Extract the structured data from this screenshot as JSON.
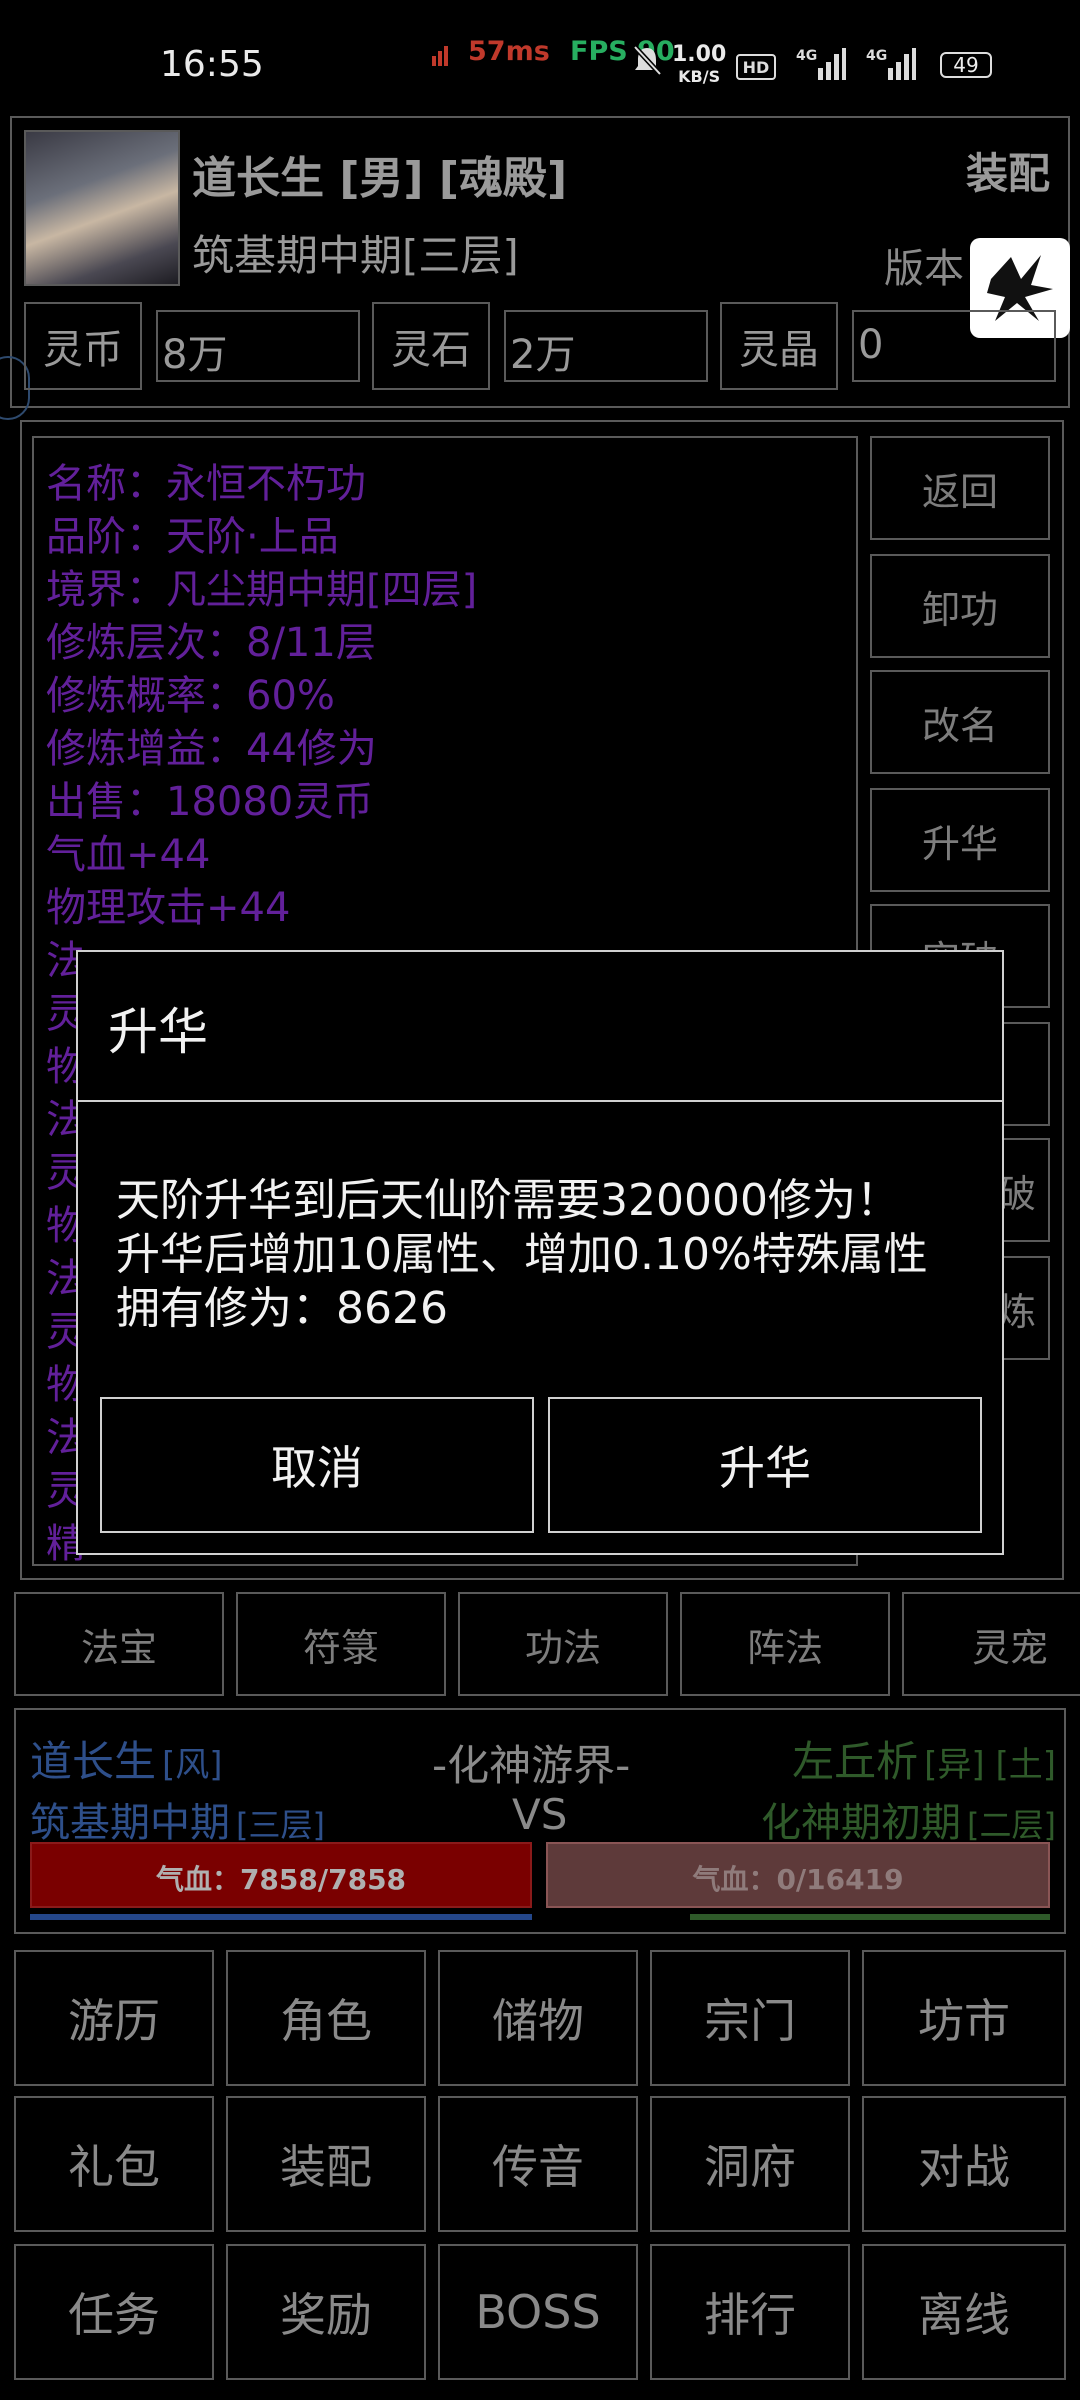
{
  "status_bar": {
    "time": "16:55",
    "latency": "57ms",
    "fps": "FPS 90",
    "speed": "1.00",
    "speed_unit": "KB/S",
    "battery": "49"
  },
  "player": {
    "name_line": "道长生 [男] [魂殿]",
    "realm": "筑基期中期[三层]",
    "equip_label": "装配",
    "version_label": "版本",
    "currencies": [
      {
        "label": "灵币",
        "value": "8万"
      },
      {
        "label": "灵石",
        "value": "2万"
      },
      {
        "label": "灵晶",
        "value": "0"
      }
    ]
  },
  "skill_details": [
    "名称：永恒不朽功",
    "品阶：天阶·上品",
    "境界：凡尘期中期[四层]",
    "修炼层次：8/11层",
    "修炼概率：60%",
    "修炼增益：44修为",
    "出售：18080灵币",
    "气血+44",
    "物理攻击+44",
    "法",
    "灵",
    "物",
    "法",
    "灵",
    "物",
    "法",
    "灵",
    "物",
    "法",
    "灵",
    "精"
  ],
  "side_actions": [
    "返回",
    "卸功",
    "改名",
    "升华",
    "突破",
    "",
    "破",
    "炼"
  ],
  "tabs": [
    "法宝",
    "符箓",
    "功法",
    "阵法",
    "灵宠"
  ],
  "battle": {
    "left_name": "道长生",
    "left_element": "[风]",
    "left_realm": "筑基期中期",
    "left_layer": "[三层]",
    "location": "-化神游界-",
    "vs": "VS",
    "right_name": "左丘析",
    "right_tags": "[异] [土]",
    "right_realm": "化神期初期",
    "right_layer": "[二层]",
    "left_hp": "气血：7858/7858",
    "right_hp": "气血：0/16419",
    "left_hp_fraction": 1.0,
    "right_hp_fraction": 0.0
  },
  "menu": [
    [
      "游历",
      "角色",
      "储物",
      "宗门",
      "坊市"
    ],
    [
      "礼包",
      "装配",
      "传音",
      "洞府",
      "对战"
    ],
    [
      "任务",
      "奖励",
      "BOSS",
      "排行",
      "离线"
    ]
  ],
  "dialog": {
    "title": "升华",
    "line1": "天阶升华到后天仙阶需要320000修为！",
    "line2": "升华后增加10属性、增加0.10%特殊属性",
    "line3": "拥有修为：8626",
    "cancel": "取消",
    "confirm": "升华"
  },
  "colors": {
    "stat_text": "#62209a",
    "hp_bar": "#7a0000",
    "enemy_hp_bar": "#5e3a3a",
    "left_name": "#2e4f8a",
    "right_name": "#2f5a2a"
  }
}
